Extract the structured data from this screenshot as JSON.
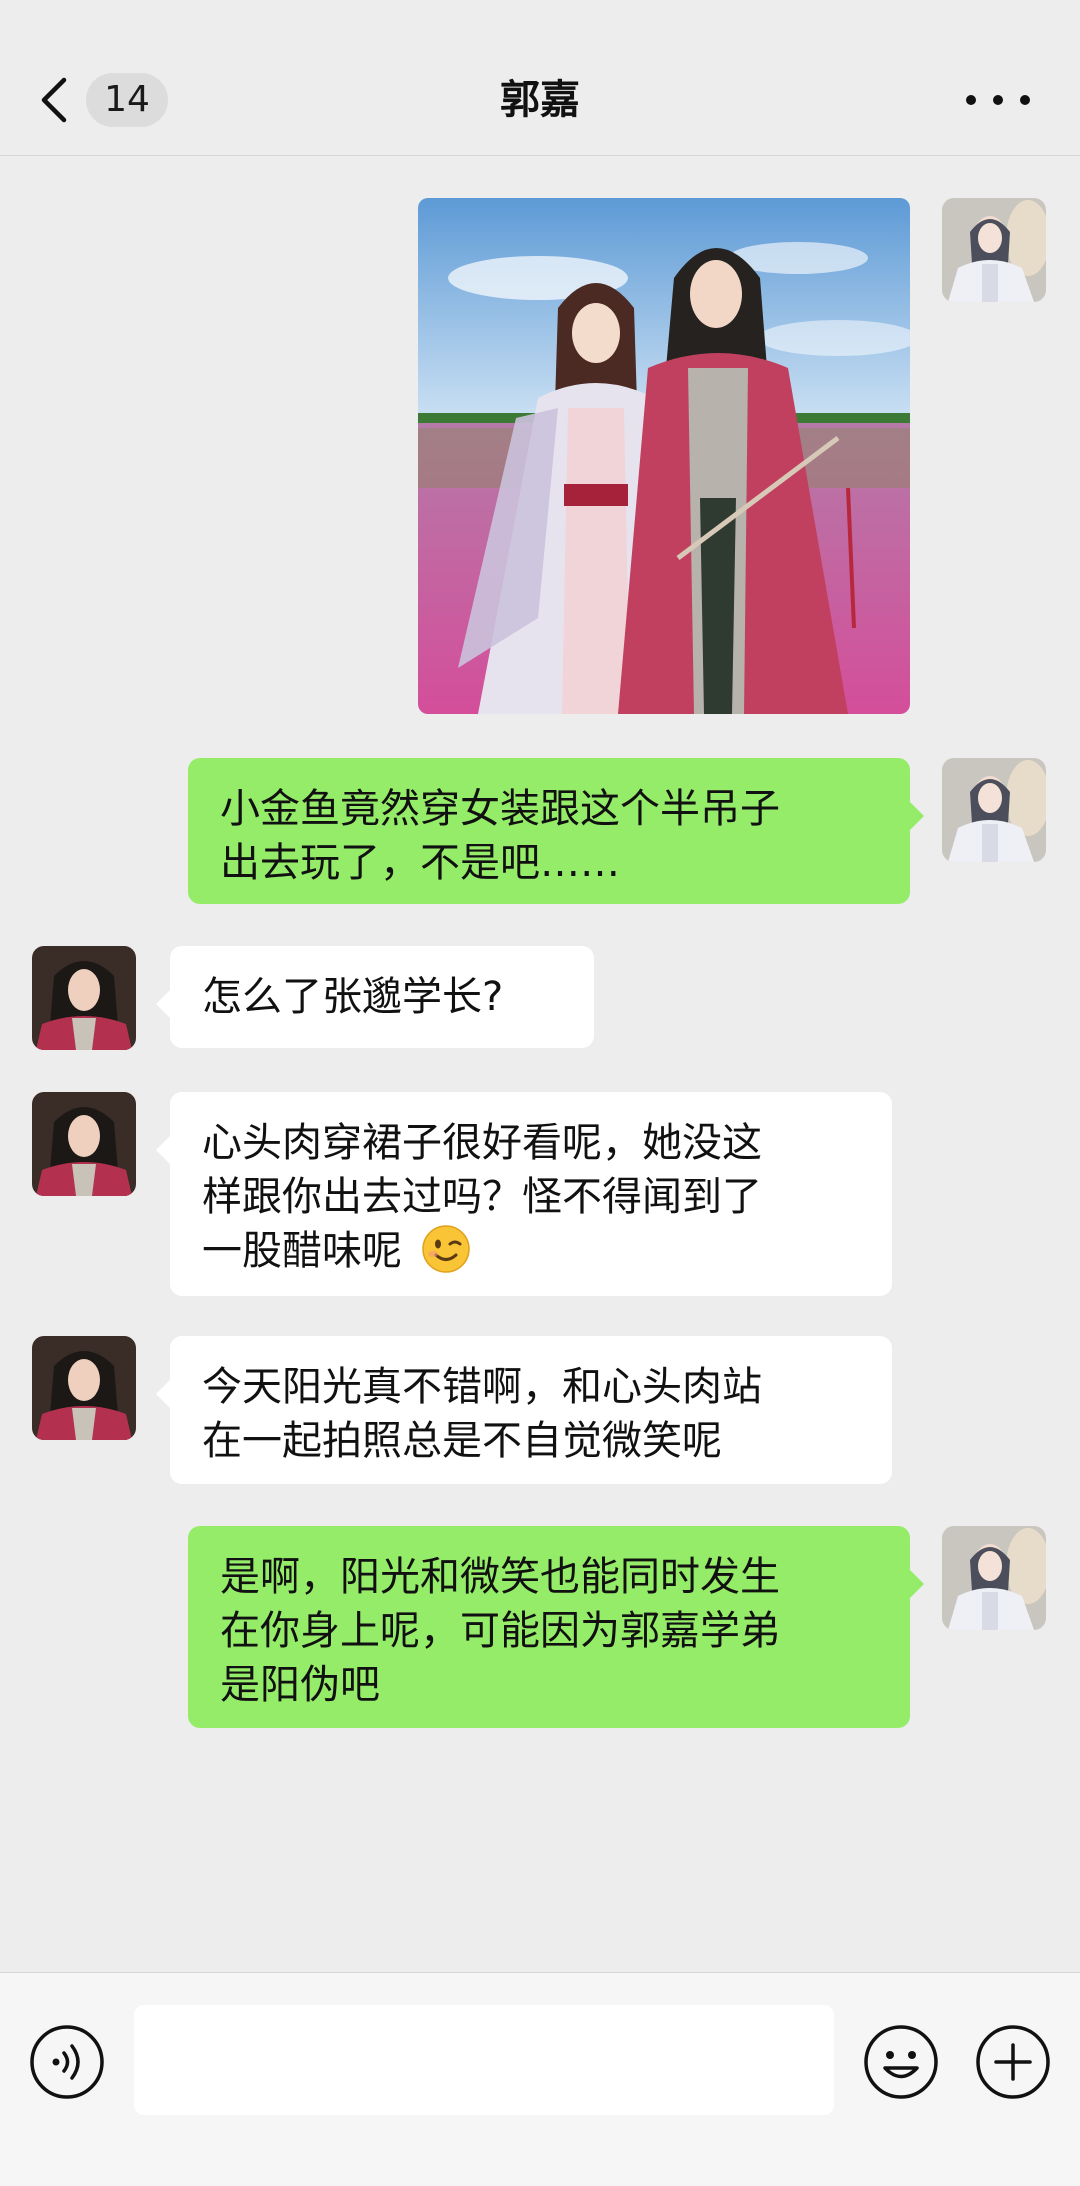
{
  "header": {
    "back_label": "back",
    "unread_count": "14",
    "title": "郭嘉"
  },
  "messages": [
    {
      "from": "me",
      "type": "image",
      "description_icon": "photo-message"
    },
    {
      "from": "me",
      "type": "text",
      "lines": [
        "小金鱼竟然穿女装跟这个半吊子",
        "出去玩了，不是吧……"
      ]
    },
    {
      "from": "contact",
      "type": "text",
      "lines": [
        "怎么了张邈学长?"
      ]
    },
    {
      "from": "contact",
      "type": "text",
      "lines": [
        "心头肉穿裙子很好看呢，她没这",
        "样跟你出去过吗？怪不得闻到了",
        "一股醋味呢"
      ],
      "emoji": "winking-face"
    },
    {
      "from": "contact",
      "type": "text",
      "lines": [
        "今天阳光真不错啊，和心头肉站",
        "在一起拍照总是不自觉微笑呢"
      ]
    },
    {
      "from": "me",
      "type": "text",
      "lines": [
        "是啊，阳光和微笑也能同时发生",
        "在你身上呢，可能因为郭嘉学弟",
        "是阳伪吧"
      ]
    }
  ],
  "input_bar": {
    "placeholder": "",
    "icons": [
      "voice-icon",
      "emoji-icon",
      "plus-icon"
    ]
  },
  "colors": {
    "background": "#ededed",
    "my_bubble": "#95ec69",
    "their_bubble": "#ffffff"
  }
}
